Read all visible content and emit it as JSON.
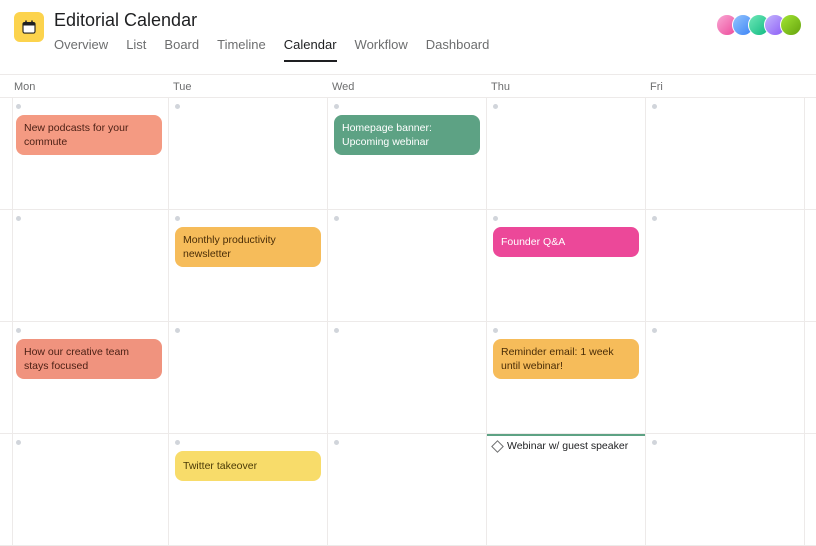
{
  "header": {
    "title": "Editorial Calendar",
    "tabs": [
      {
        "label": "Overview",
        "active": false
      },
      {
        "label": "List",
        "active": false
      },
      {
        "label": "Board",
        "active": false
      },
      {
        "label": "Timeline",
        "active": false
      },
      {
        "label": "Calendar",
        "active": true
      },
      {
        "label": "Workflow",
        "active": false
      },
      {
        "label": "Dashboard",
        "active": false
      }
    ]
  },
  "days": [
    "Mon",
    "Tue",
    "Wed",
    "Thu",
    "Fri"
  ],
  "events": {
    "w1_mon": {
      "text": "New podcasts for your commute",
      "color": "orange"
    },
    "w1_wed": {
      "text": "Homepage banner: Upcoming webinar",
      "color": "green"
    },
    "w2_tue": {
      "text": "Monthly productivity newsletter",
      "color": "amber"
    },
    "w2_thu": {
      "text": "Founder Q&A",
      "color": "pink"
    },
    "w3_mon": {
      "text": "How our creative team stays focused",
      "color": "salmon"
    },
    "w3_thu": {
      "text": "Reminder email: 1 week until webinar!",
      "color": "amber"
    },
    "w4_tue": {
      "text": "Twitter takeover",
      "color": "yellow"
    },
    "w4_thu_milestone": {
      "text": "Webinar w/ guest speaker"
    }
  }
}
